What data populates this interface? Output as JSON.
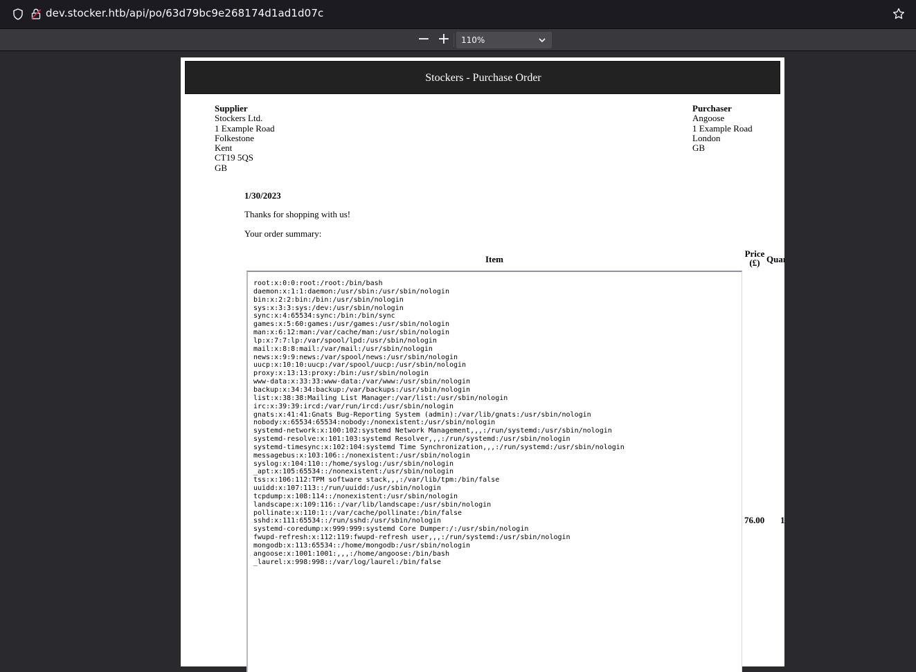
{
  "browser": {
    "url": "dev.stocker.htb/api/po/63d79bc9e268174d1ad1d07c"
  },
  "pdf_toolbar": {
    "zoom_out": "−",
    "zoom_in": "+",
    "zoom_level": "110%"
  },
  "document": {
    "title": "Stockers - Purchase Order",
    "supplier": {
      "label": "Supplier",
      "lines": [
        "Stockers Ltd.",
        "1 Example Road",
        "Folkestone",
        "Kent",
        "CT19 5QS",
        "GB"
      ]
    },
    "purchaser": {
      "label": "Purchaser",
      "lines": [
        "Angoose",
        "1 Example Road",
        "London",
        "GB"
      ]
    },
    "date": "1/30/2023",
    "thanks": "Thanks for shopping with us!",
    "summary": "Your order summary:",
    "table": {
      "headers": {
        "item": "Item",
        "price_line1": "Price",
        "price_line2": "(£)",
        "quantity": "Quantity"
      },
      "row": {
        "item_content": "root:x:0:0:root:/root:/bin/bash\ndaemon:x:1:1:daemon:/usr/sbin:/usr/sbin/nologin\nbin:x:2:2:bin:/bin:/usr/sbin/nologin\nsys:x:3:3:sys:/dev:/usr/sbin/nologin\nsync:x:4:65534:sync:/bin:/bin/sync\ngames:x:5:60:games:/usr/games:/usr/sbin/nologin\nman:x:6:12:man:/var/cache/man:/usr/sbin/nologin\nlp:x:7:7:lp:/var/spool/lpd:/usr/sbin/nologin\nmail:x:8:8:mail:/var/mail:/usr/sbin/nologin\nnews:x:9:9:news:/var/spool/news:/usr/sbin/nologin\nuucp:x:10:10:uucp:/var/spool/uucp:/usr/sbin/nologin\nproxy:x:13:13:proxy:/bin:/usr/sbin/nologin\nwww-data:x:33:33:www-data:/var/www:/usr/sbin/nologin\nbackup:x:34:34:backup:/var/backups:/usr/sbin/nologin\nlist:x:38:38:Mailing List Manager:/var/list:/usr/sbin/nologin\nirc:x:39:39:ircd:/var/run/ircd:/usr/sbin/nologin\ngnats:x:41:41:Gnats Bug-Reporting System (admin):/var/lib/gnats:/usr/sbin/nologin\nnobody:x:65534:65534:nobody:/nonexistent:/usr/sbin/nologin\nsystemd-network:x:100:102:systemd Network Management,,,:/run/systemd:/usr/sbin/nologin\nsystemd-resolve:x:101:103:systemd Resolver,,,:/run/systemd:/usr/sbin/nologin\nsystemd-timesync:x:102:104:systemd Time Synchronization,,,:/run/systemd:/usr/sbin/nologin\nmessagebus:x:103:106::/nonexistent:/usr/sbin/nologin\nsyslog:x:104:110::/home/syslog:/usr/sbin/nologin\n_apt:x:105:65534::/nonexistent:/usr/sbin/nologin\ntss:x:106:112:TPM software stack,,,:/var/lib/tpm:/bin/false\nuuidd:x:107:113::/run/uuidd:/usr/sbin/nologin\ntcpdump:x:108:114::/nonexistent:/usr/sbin/nologin\nlandscape:x:109:116::/var/lib/landscape:/usr/sbin/nologin\npollinate:x:110:1::/var/cache/pollinate:/bin/false\nsshd:x:111:65534::/run/sshd:/usr/sbin/nologin\nsystemd-coredump:x:999:999:systemd Core Dumper:/:/usr/sbin/nologin\nfwupd-refresh:x:112:119:fwupd-refresh user,,,:/run/systemd:/usr/sbin/nologin\nmongodb:x:113:65534::/home/mongodb:/usr/sbin/nologin\nangoose:x:1001:1001:,,,:/home/angoose:/bin/bash\n_laurel:x:998:998::/var/log/laurel:/bin/false",
        "price": "76.00",
        "quantity": "1"
      }
    }
  }
}
